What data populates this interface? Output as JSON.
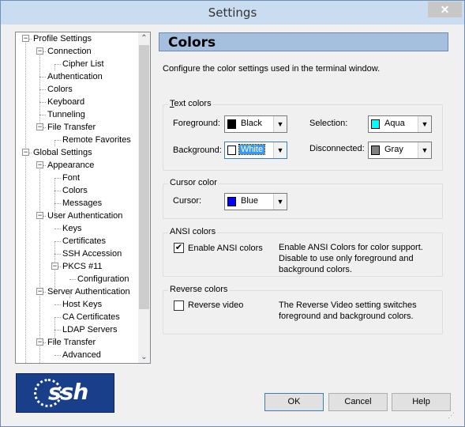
{
  "window": {
    "title": "Settings",
    "close": "✕"
  },
  "tree": {
    "items": [
      {
        "label": "Profile Settings",
        "level": 0,
        "expander": "−"
      },
      {
        "label": "Connection",
        "level": 1,
        "expander": "−"
      },
      {
        "label": "Cipher List",
        "level": 2
      },
      {
        "label": "Authentication",
        "level": 1
      },
      {
        "label": "Colors",
        "level": 1
      },
      {
        "label": "Keyboard",
        "level": 1
      },
      {
        "label": "Tunneling",
        "level": 1
      },
      {
        "label": "File Transfer",
        "level": 1,
        "expander": "−"
      },
      {
        "label": "Remote Favorites",
        "level": 2
      },
      {
        "label": "Global Settings",
        "level": 0,
        "expander": "−"
      },
      {
        "label": "Appearance",
        "level": 1,
        "expander": "−"
      },
      {
        "label": "Font",
        "level": 2
      },
      {
        "label": "Colors",
        "level": 2
      },
      {
        "label": "Messages",
        "level": 2
      },
      {
        "label": "User Authentication",
        "level": 1,
        "expander": "−"
      },
      {
        "label": "Keys",
        "level": 2
      },
      {
        "label": "Certificates",
        "level": 2
      },
      {
        "label": "SSH Accession",
        "level": 2
      },
      {
        "label": "PKCS #11",
        "level": 2,
        "expander": "−"
      },
      {
        "label": "Configuration",
        "level": 3
      },
      {
        "label": "Server Authentication",
        "level": 1,
        "expander": "−"
      },
      {
        "label": "Host Keys",
        "level": 2
      },
      {
        "label": "CA Certificates",
        "level": 2
      },
      {
        "label": "LDAP Servers",
        "level": 2
      },
      {
        "label": "File Transfer",
        "level": 1,
        "expander": "−"
      },
      {
        "label": "Advanced",
        "level": 2
      }
    ],
    "scroll_up": "⌃",
    "scroll_down": "⌄"
  },
  "logo": {
    "text": "ssh"
  },
  "panel": {
    "title": "Colors",
    "description": "Configure the color settings used in the terminal window."
  },
  "text_colors": {
    "legend": "Text colors",
    "foreground_label": "Foreground:",
    "foreground_value": "Black",
    "foreground_color": "#000000",
    "selection_label": "Selection:",
    "selection_value": "Aqua",
    "selection_color": "#00ffff",
    "background_label": "Background:",
    "background_value": "White",
    "background_color": "#ffffff",
    "disconnected_label": "Disconnected:",
    "disconnected_value": "Gray",
    "disconnected_color": "#808080"
  },
  "cursor_color": {
    "legend": "Cursor color",
    "cursor_label": "Cursor:",
    "cursor_value": "Blue",
    "cursor_color": "#0000ff"
  },
  "ansi_colors": {
    "legend": "ANSI colors",
    "checkbox_label": "Enable ANSI colors",
    "checked": true,
    "note": "Enable ANSI Colors for color support. Disable to use only foreground and background colors."
  },
  "reverse_colors": {
    "legend": "Reverse colors",
    "checkbox_label": "Reverse video",
    "checked": false,
    "note": "The Reverse Video setting switches foreground and background colors."
  },
  "buttons": {
    "ok": "OK",
    "cancel": "Cancel",
    "help": "Help"
  }
}
